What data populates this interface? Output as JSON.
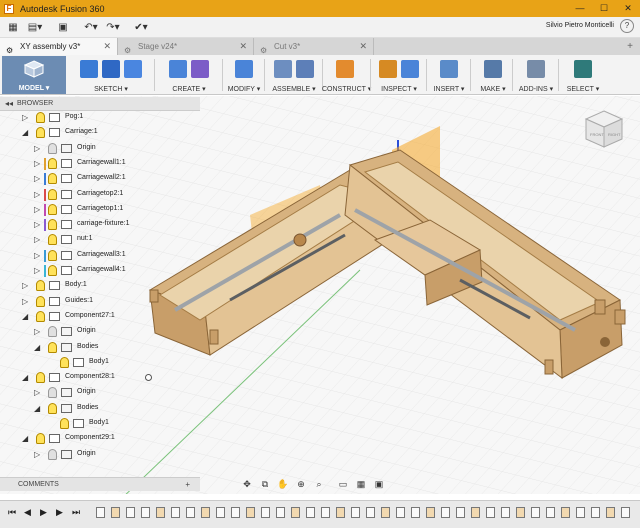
{
  "window": {
    "title": "Autodesk Fusion 360",
    "minimize": "—",
    "maximize": "☐",
    "close": "✕"
  },
  "qat": {
    "user": "Silvio Pietro Monticelli",
    "help": "?"
  },
  "tabs": [
    {
      "label": "XY assembly v3*",
      "active": true
    },
    {
      "label": "Stage v24*",
      "active": false
    },
    {
      "label": "Cut v3*",
      "active": false
    }
  ],
  "toolbar": {
    "model": "MODEL ▾",
    "groups": [
      {
        "label": "SKETCH ▾",
        "icons": [
          "#3a7bd5",
          "#2f68c4",
          "#4a86e0"
        ]
      },
      {
        "label": "CREATE ▾",
        "icons": [
          "#4a84d8",
          "#7c5cc7"
        ]
      },
      {
        "label": "MODIFY ▾",
        "icons": [
          "#4a84d8"
        ]
      },
      {
        "label": "ASSEMBLE ▾",
        "icons": [
          "#6d8ec0",
          "#5d7fb8"
        ]
      },
      {
        "label": "CONSTRUCT ▾",
        "icons": [
          "#e38b2e"
        ]
      },
      {
        "label": "INSPECT ▾",
        "icons": [
          "#d68a23",
          "#4a84d8"
        ]
      },
      {
        "label": "INSERT ▾",
        "icons": [
          "#5a8bc9"
        ]
      },
      {
        "label": "MAKE ▾",
        "icons": [
          "#567aa8"
        ]
      },
      {
        "label": "ADD-INS ▾",
        "icons": [
          "#778ca8"
        ]
      },
      {
        "label": "SELECT ▾",
        "icons": [
          "#2f7a7a"
        ]
      }
    ]
  },
  "browser": {
    "title": "BROWSER",
    "items": [
      {
        "label": "Pog:1",
        "indent": 1,
        "expand": "▷",
        "icon": "link",
        "bar": "",
        "vis": true
      },
      {
        "label": "Carriage:1",
        "indent": 1,
        "expand": "◢",
        "icon": "link",
        "bar": "",
        "vis": true
      },
      {
        "label": "Origin",
        "indent": 2,
        "expand": "▷",
        "icon": "folder",
        "bar": "",
        "vis": false
      },
      {
        "label": "Carriagewall1:1",
        "indent": 2,
        "expand": "▷",
        "icon": "body",
        "bar": "#e0a030",
        "vis": true
      },
      {
        "label": "Carriagewall2:1",
        "indent": 2,
        "expand": "▷",
        "icon": "body",
        "bar": "#3a7bd5",
        "vis": true
      },
      {
        "label": "Carriagetop2:1",
        "indent": 2,
        "expand": "▷",
        "icon": "body",
        "bar": "#d94a4a",
        "vis": true
      },
      {
        "label": "Carriagetop1:1",
        "indent": 2,
        "expand": "▷",
        "icon": "body",
        "bar": "#c04ab0",
        "vis": true
      },
      {
        "label": "carriage-fixture:1",
        "indent": 2,
        "expand": "▷",
        "icon": "body",
        "bar": "#8a5ad0",
        "vis": true
      },
      {
        "label": "nut:1",
        "indent": 2,
        "expand": "▷",
        "icon": "body",
        "bar": "",
        "vis": true
      },
      {
        "label": "Carriagewall3:1",
        "indent": 2,
        "expand": "▷",
        "icon": "body",
        "bar": "#3a9ad5",
        "vis": true
      },
      {
        "label": "Carriagewall4:1",
        "indent": 2,
        "expand": "▷",
        "icon": "body",
        "bar": "#3ab5d5",
        "vis": true
      },
      {
        "label": "Body:1",
        "indent": 1,
        "expand": "▷",
        "icon": "link",
        "bar": "",
        "vis": true
      },
      {
        "label": "Guides:1",
        "indent": 1,
        "expand": "▷",
        "icon": "link",
        "bar": "",
        "vis": true
      },
      {
        "label": "Component27:1",
        "indent": 1,
        "expand": "◢",
        "icon": "body",
        "bar": "",
        "vis": true
      },
      {
        "label": "Origin",
        "indent": 2,
        "expand": "▷",
        "icon": "folder",
        "bar": "",
        "vis": false
      },
      {
        "label": "Bodies",
        "indent": 2,
        "expand": "◢",
        "icon": "folder",
        "bar": "",
        "vis": true
      },
      {
        "label": "Body1",
        "indent": 3,
        "expand": "",
        "icon": "bodyw",
        "bar": "",
        "vis": true
      },
      {
        "label": "Component28:1",
        "indent": 1,
        "expand": "◢",
        "icon": "body",
        "bar": "",
        "vis": true,
        "radio": true
      },
      {
        "label": "Origin",
        "indent": 2,
        "expand": "▷",
        "icon": "folder",
        "bar": "",
        "vis": false
      },
      {
        "label": "Bodies",
        "indent": 2,
        "expand": "◢",
        "icon": "folder",
        "bar": "",
        "vis": true
      },
      {
        "label": "Body1",
        "indent": 3,
        "expand": "",
        "icon": "bodyw",
        "bar": "",
        "vis": true
      },
      {
        "label": "Component29:1",
        "indent": 1,
        "expand": "◢",
        "icon": "body",
        "bar": "",
        "vis": true
      },
      {
        "label": "Origin",
        "indent": 2,
        "expand": "▷",
        "icon": "folder",
        "bar": "",
        "vis": false
      }
    ]
  },
  "comments": {
    "title": "COMMENTS",
    "add": "+"
  },
  "viewcube": {
    "front": "FRONT",
    "right": "RIGHT"
  },
  "playback": [
    "⏮",
    "◀",
    "▶",
    "▶",
    "⏭"
  ],
  "colors": {
    "titlebar": "#e8a317",
    "model": "#6c8cb3",
    "wood": "#d7b27f",
    "wood_dark": "#a47c45",
    "highlight": "#f5a623"
  }
}
